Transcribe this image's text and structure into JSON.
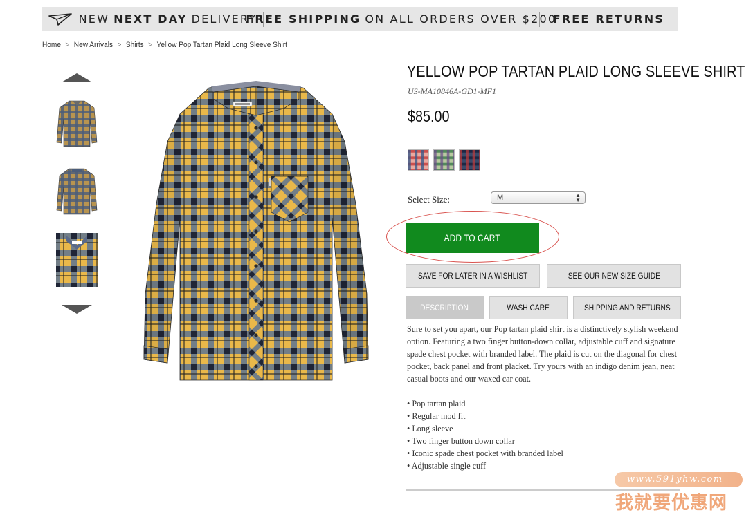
{
  "promo": {
    "seg1_pre": "NEW",
    "seg1_bold": "NEXT DAY",
    "seg1_post": "DELIVERY",
    "seg2_bold": "FREE SHIPPING",
    "seg2_post": "ON ALL ORDERS OVER $200",
    "seg3_bold": "FREE RETURNS"
  },
  "breadcrumb": {
    "items": [
      "Home",
      "New Arrivals",
      "Shirts",
      "Yellow Pop Tartan Plaid Long Sleeve Shirt"
    ],
    "separator": ">"
  },
  "product": {
    "title": "YELLOW POP TARTAN PLAID LONG SLEEVE SHIRT",
    "sku": "US-MA10846A-GD1-MF1",
    "price": "$85.00",
    "swatches": [
      "tartan-red-swatch",
      "tartan-green-swatch",
      "tartan-navy-swatch"
    ],
    "size_label": "Select Size:",
    "size_value": "M",
    "add_to_cart": "ADD TO CART",
    "wishlist": "SAVE FOR LATER IN A WISHLIST",
    "size_guide": "SEE OUR NEW SIZE GUIDE",
    "tabs": [
      "DESCRIPTION",
      "WASH CARE",
      "SHIPPING AND RETURNS"
    ],
    "active_tab": "DESCRIPTION",
    "description": "Sure to set you apart, our Pop tartan plaid shirt is a distinctively stylish weekend option. Featuring a two finger button-down collar, adjustable cuff and signature spade chest pocket with branded label. The plaid is cut on the diagonal for chest pocket, back panel and front placket. Try yours with an indigo denim jean, neat casual boots and our waxed car coat.",
    "features": [
      "Pop tartan plaid",
      "Regular mod fit",
      "Long sleeve",
      "Two finger button down collar",
      "Iconic spade chest pocket with branded label",
      "Adjustable single cuff"
    ]
  },
  "watermark": {
    "url": "www.591yhw.com",
    "text": "我就要优惠网"
  },
  "colors": {
    "add_to_cart": "#118a1e",
    "promo_bg": "#e6e6e6",
    "button_bg": "#e2e2e2",
    "active_tab_bg": "#c9c9c9",
    "annotation": "#d9534f"
  },
  "icons": {
    "promo": "paper-plane-icon",
    "thumb_prev": "arrow-up-icon",
    "thumb_next": "arrow-down-icon",
    "select": "updown-icon"
  }
}
